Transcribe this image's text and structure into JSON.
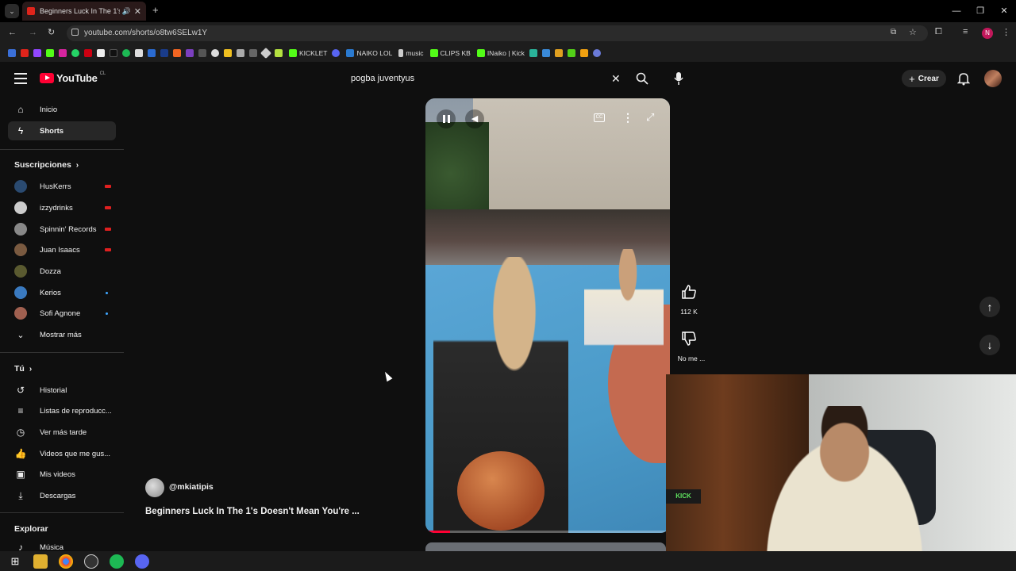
{
  "browser": {
    "tab_title": "Beginners Luck In The 1's D",
    "url": "youtube.com/shorts/o8tw6SELw1Y",
    "bookmarks": [
      "KICKLET",
      "NAIKO LOL",
      "music",
      "CLIPS KB",
      "INaiko | Kick"
    ]
  },
  "youtube": {
    "logo_text": "YouTube",
    "logo_country": "CL",
    "search_value": "pogba juventyus",
    "create_label": "Crear"
  },
  "sidebar": {
    "main": [
      {
        "label": "Inicio",
        "icon": "home-icon"
      },
      {
        "label": "Shorts",
        "icon": "shorts-icon"
      }
    ],
    "subscriptions_title": "Suscripciones",
    "subscriptions": [
      {
        "label": "HusKerrs",
        "status": "live"
      },
      {
        "label": "izzydrinks",
        "status": "live"
      },
      {
        "label": "Spinnin' Records",
        "status": "live"
      },
      {
        "label": "Juan Isaacs",
        "status": "live"
      },
      {
        "label": "Dozza",
        "status": ""
      },
      {
        "label": "Kerios",
        "status": "new"
      },
      {
        "label": "Sofi Agnone",
        "status": "new"
      }
    ],
    "show_more": "Mostrar más",
    "you_title": "Tú",
    "you_items": [
      {
        "label": "Historial",
        "icon": "history-icon"
      },
      {
        "label": "Listas de reproducc...",
        "icon": "playlist-icon"
      },
      {
        "label": "Ver más tarde",
        "icon": "clock-icon"
      },
      {
        "label": "Videos que me gus...",
        "icon": "thumbs-up-icon"
      },
      {
        "label": "Mis videos",
        "icon": "video-icon"
      },
      {
        "label": "Descargas",
        "icon": "download-icon"
      }
    ],
    "explore_title": "Explorar",
    "explore_items": [
      {
        "label": "Música",
        "icon": "music-icon"
      }
    ]
  },
  "short": {
    "channel": "@mkiatipis",
    "title": "Beginners Luck In The 1's Doesn't Mean You're ...",
    "like_count": "112 K",
    "dislike_label": "No me ...",
    "progress": 0.1
  },
  "webcam": {
    "badge_text": "KICK"
  }
}
